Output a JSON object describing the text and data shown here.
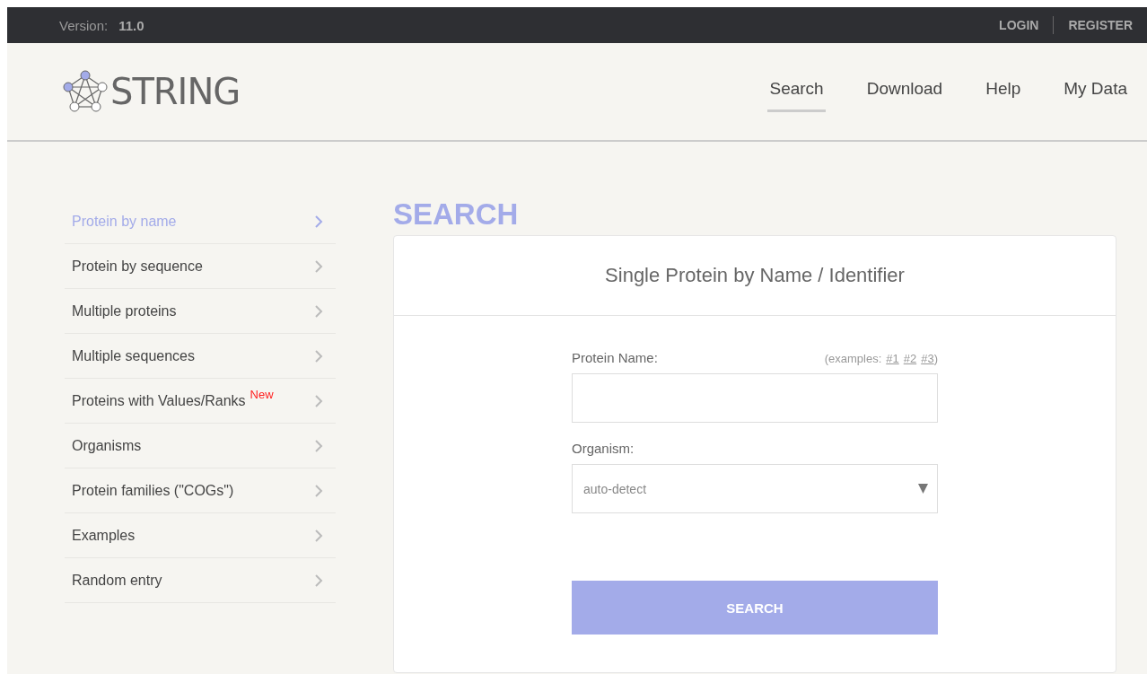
{
  "top_bar": {
    "version_label": "Version:",
    "version": "11.0",
    "links": [
      "LOGIN",
      "REGISTER"
    ]
  },
  "header": {
    "logo_text": "STRING",
    "nav": [
      {
        "label": "Search",
        "selected": true
      },
      {
        "label": "Download",
        "selected": false
      },
      {
        "label": "Help",
        "selected": false
      },
      {
        "label": "My Data",
        "selected": false
      }
    ]
  },
  "sidebar": {
    "items": [
      {
        "label": "Protein by name",
        "selected": true
      },
      {
        "label": "Protein by sequence",
        "selected": false
      },
      {
        "label": "Multiple proteins",
        "selected": false
      },
      {
        "label": "Multiple sequences",
        "selected": false
      },
      {
        "label": "Proteins with Values/Ranks",
        "selected": false,
        "badge": "New"
      },
      {
        "label": "Organisms",
        "selected": false
      },
      {
        "label": "Protein families (\"COGs\")",
        "selected": false
      },
      {
        "label": "Examples",
        "selected": false
      },
      {
        "label": "Random entry",
        "selected": false
      }
    ]
  },
  "main": {
    "heading": "SEARCH",
    "card_title": "Single Protein by Name / Identifier",
    "protein_name": {
      "label": "Protein Name:",
      "examples_open": "(examples:",
      "examples": [
        "#1",
        "#2",
        "#3"
      ],
      "examples_close": ")"
    },
    "organism": {
      "label": "Organism:",
      "value": "auto-detect"
    },
    "button": "SEARCH"
  }
}
